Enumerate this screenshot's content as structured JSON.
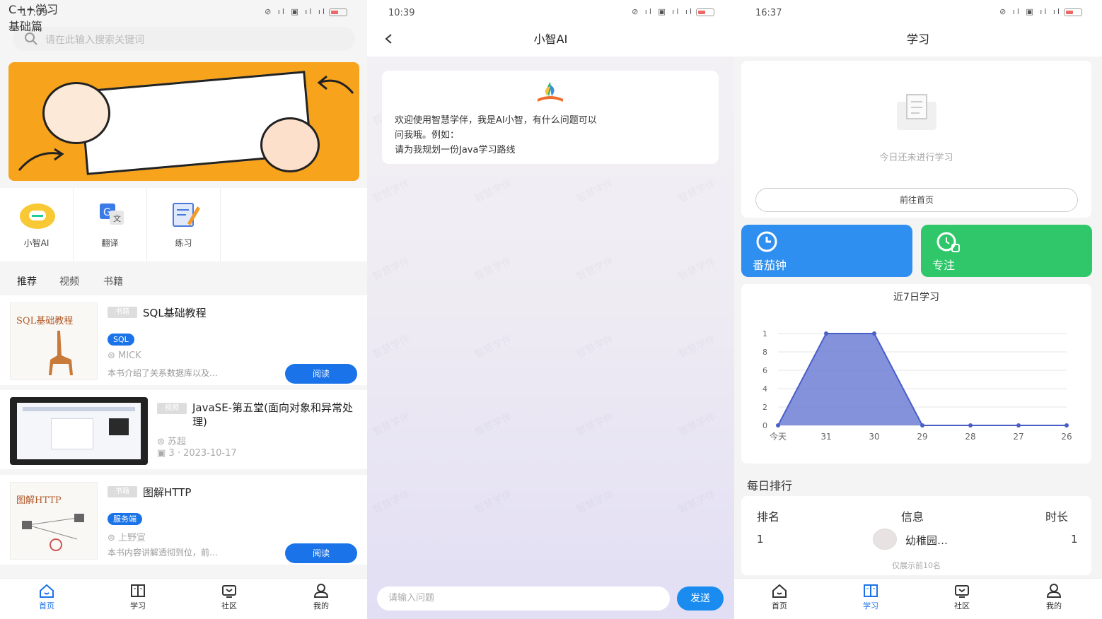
{
  "screen1": {
    "status": {
      "time": "17:09",
      "icons": "⊘ ıl ▣ ıl ıl"
    },
    "search": {
      "placeholder": "请在此输入搜索关键词",
      "icon": "search-icon"
    },
    "banner": {
      "line1": "C++学习",
      "line2": "基础篇"
    },
    "quick": [
      {
        "label": "小智AI",
        "icon": "ai-robot-icon"
      },
      {
        "label": "翻译",
        "icon": "translate-icon"
      },
      {
        "label": "练习",
        "icon": "practice-pencil-icon"
      }
    ],
    "tabs": [
      "推荐",
      "视频",
      "书籍"
    ],
    "books": [
      {
        "tag": "书籍",
        "title": "SQL基础教程",
        "cover_title": "SQL基础教程",
        "chip": "SQL",
        "author": "MICK",
        "desc": "本书介绍了关系数据库以及…",
        "action": "阅读"
      },
      {
        "tag": "书籍",
        "title": "图解HTTP",
        "cover_title": "图解HTTP",
        "chip": "服务端",
        "author": "上野宣",
        "desc": "本书内容讲解透彻到位，前…",
        "action": "阅读"
      }
    ],
    "video": {
      "tag": "视频",
      "title": "JavaSE-第五堂(面向对象和异常处理)",
      "author": "苏超",
      "count": "3",
      "date": "2023-10-17"
    },
    "nav": [
      {
        "label": "首页",
        "icon": "home-icon",
        "active": true
      },
      {
        "label": "学习",
        "icon": "book-icon",
        "active": false
      },
      {
        "label": "社区",
        "icon": "community-icon",
        "active": false
      },
      {
        "label": "我的",
        "icon": "user-icon",
        "active": false
      }
    ]
  },
  "screen2": {
    "status": {
      "time": "10:39",
      "icons": "⊘ ıl ▣ ıl ıl"
    },
    "title": "小智AI",
    "watermark": "智慧学伴",
    "message": {
      "line1": "欢迎使用智慧学伴，我是AI小智，有什么问题可以",
      "line2": "问我哦。例如：",
      "line3": "请为我规划一份Java学习路线"
    },
    "input": {
      "placeholder": "请输入问题"
    },
    "send": "发送"
  },
  "screen3": {
    "status": {
      "time": "16:37",
      "icons": "⊘ ıl ▣ ıl ıl"
    },
    "title": "学习",
    "empty_text": "今日还未进行学习",
    "goto_home": "前往首页",
    "tiles": [
      {
        "label": "番茄钟",
        "icon": "clock-icon",
        "color": "#2e8ff0"
      },
      {
        "label": "专注",
        "icon": "focus-timer-icon",
        "color": "#2fc76a"
      }
    ],
    "ranking": {
      "heading": "每日排行",
      "headers": [
        "排名",
        "信息",
        "时长"
      ],
      "rows": [
        {
          "rank": "1",
          "name": "幼稚园…",
          "duration": "1"
        }
      ],
      "note": "仅展示前10名"
    },
    "nav": [
      {
        "label": "首页",
        "icon": "home-icon",
        "active": false
      },
      {
        "label": "学习",
        "icon": "book-icon",
        "active": true
      },
      {
        "label": "社区",
        "icon": "community-icon",
        "active": false
      },
      {
        "label": "我的",
        "icon": "user-icon",
        "active": false
      }
    ]
  },
  "chart_data": {
    "type": "area",
    "title": "近7日学习",
    "categories": [
      "今天",
      "31",
      "30",
      "29",
      "28",
      "27",
      "26"
    ],
    "yticks": [
      "0",
      "2",
      "4",
      "6",
      "8",
      "1"
    ],
    "values": [
      0,
      1,
      1,
      0,
      0,
      0,
      0
    ],
    "ylim": [
      0,
      1
    ],
    "color": "#6f7fd6",
    "grid": true
  }
}
